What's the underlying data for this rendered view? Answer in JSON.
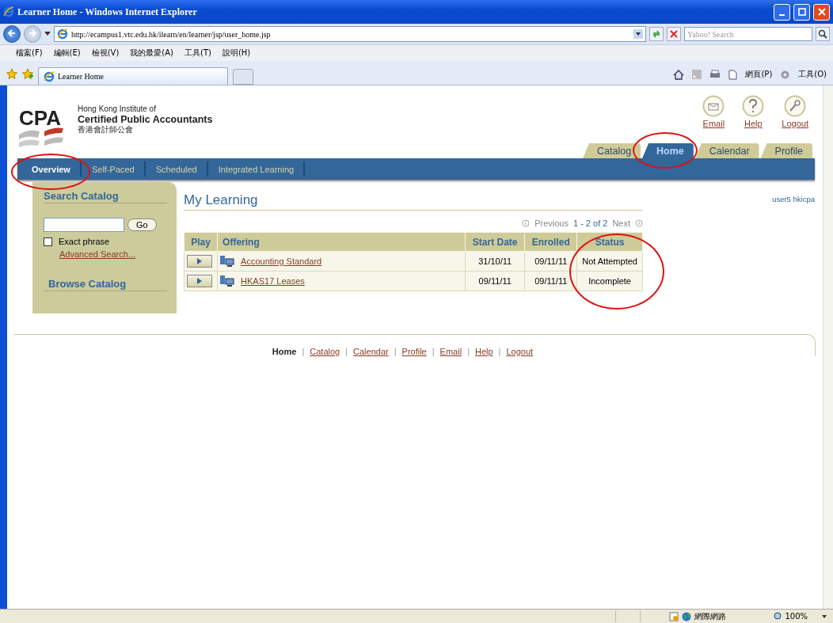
{
  "window": {
    "title": "Learner Home - Windows Internet Explorer"
  },
  "address_bar": {
    "url": "http://ecampus1.vtc.edu.hk/ilearn/en/learner/jsp/user_home.jsp"
  },
  "search_box": {
    "placeholder": "Yahoo! Search"
  },
  "menu_bar": [
    "檔案(F)",
    "編輯(E)",
    "檢視(V)",
    "我的最愛(A)",
    "工具(T)",
    "說明(H)"
  ],
  "browser_tabs": [
    {
      "label": "Learner Home",
      "selected": true
    }
  ],
  "command_bar": [
    "網頁(P)",
    "工具(O)"
  ],
  "header": {
    "logo_text": "CPA",
    "org_line_1": "Hong Kong Institute of",
    "org_line_2": "Certified Public Accountants",
    "org_line_3": "香港會計師公會",
    "quick_links": [
      "Email",
      "Help",
      "Logout"
    ],
    "main_tabs": [
      {
        "label": "Catalog",
        "selected": false,
        "circled": false
      },
      {
        "label": "Home",
        "selected": true,
        "circled": true
      },
      {
        "label": "Calendar",
        "selected": false,
        "circled": false
      },
      {
        "label": "Profile",
        "selected": false,
        "circled": false
      }
    ],
    "sub_tabs": [
      {
        "label": "Overview",
        "selected": true,
        "circled": true
      },
      {
        "label": "Self-Paced",
        "selected": false,
        "circled": false
      },
      {
        "label": "Scheduled",
        "selected": false,
        "circled": false
      },
      {
        "label": "Integrated Learning",
        "selected": false,
        "circled": false
      }
    ]
  },
  "sidebar": {
    "search_title": "Search Catalog",
    "go_button": "Go",
    "exact_phrase": {
      "label": "Exact phrase",
      "checked": false
    },
    "advanced_link": "Advanced Search...",
    "browse_title": "Browse Catalog"
  },
  "user_label": "user5 hkicpa",
  "my_learning": {
    "title": "My Learning",
    "pager": {
      "previous": "Previous",
      "range": "1 - 2 of 2",
      "next": "Next"
    },
    "columns": [
      {
        "label": "Play",
        "circled": false
      },
      {
        "label": "Offering",
        "circled": false
      },
      {
        "label": "Start Date",
        "circled": false
      },
      {
        "label": "Enrolled",
        "circled": false
      },
      {
        "label": "Status",
        "circled": true
      }
    ],
    "rows": [
      {
        "offering": "Accounting Standard",
        "start_date": "31/10/11",
        "enrolled": "09/11/11",
        "status": "Not Attempted"
      },
      {
        "offering": "HKAS17 Leases",
        "start_date": "09/11/11",
        "enrolled": "09/11/11",
        "status": "Incomplete"
      }
    ]
  },
  "footer_links": [
    {
      "label": "Home",
      "selected": true
    },
    {
      "label": "Catalog",
      "selected": false
    },
    {
      "label": "Calendar",
      "selected": false
    },
    {
      "label": "Profile",
      "selected": false
    },
    {
      "label": "Email",
      "selected": false
    },
    {
      "label": "Help",
      "selected": false
    },
    {
      "label": "Logout",
      "selected": false
    }
  ],
  "footer_separators": [
    "|",
    "|",
    "|",
    "|",
    "|",
    "|"
  ],
  "status_bar": {
    "zone": "網際網路",
    "zoom": "100%"
  }
}
